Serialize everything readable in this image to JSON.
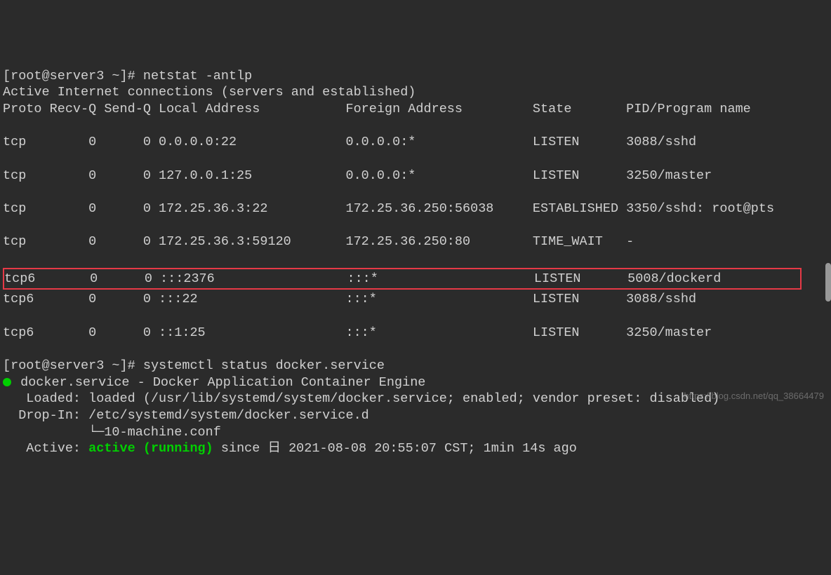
{
  "cmd1": {
    "prompt": "[root@server3 ~]# ",
    "command": "netstat -antlp"
  },
  "hdr_active": "Active Internet connections (servers and established)",
  "hdr_cols": "Proto Recv-Q Send-Q Local Address           Foreign Address         State       PID/Program name",
  "rows": [
    "tcp        0      0 0.0.0.0:22              0.0.0.0:*               LISTEN      3088/sshd",
    "tcp        0      0 127.0.0.1:25            0.0.0.0:*               LISTEN      3250/master",
    "tcp        0      0 172.25.36.3:22          172.25.36.250:56038     ESTABLISHED 3350/sshd: root@pts",
    "tcp        0      0 172.25.36.3:59120       172.25.36.250:80        TIME_WAIT   -",
    "tcp6       0      0 :::2376                 :::*                    LISTEN      5008/dockerd",
    "tcp6       0      0 :::22                   :::*                    LISTEN      3088/sshd",
    "tcp6       0      0 ::1:25                  :::*                    LISTEN      3250/master"
  ],
  "cmd2": {
    "prompt": "[root@server3 ~]# ",
    "command": "systemctl status docker.service"
  },
  "status": {
    "title": " docker.service - Docker Application Container Engine",
    "loaded": "   Loaded: loaded (/usr/lib/systemd/system/docker.service; enabled; vendor preset: disabled)",
    "dropin1": "  Drop-In: /etc/systemd/system/docker.service.d",
    "dropin2": "           └─10-machine.conf",
    "active_prefix": "   Active: ",
    "active_green": "active (running)",
    "active_suffix": " since 日 2021-08-08 20:55:07 CST; 1min 14s ago"
  },
  "watermark": "https://blog.csdn.net/qq_38664479"
}
